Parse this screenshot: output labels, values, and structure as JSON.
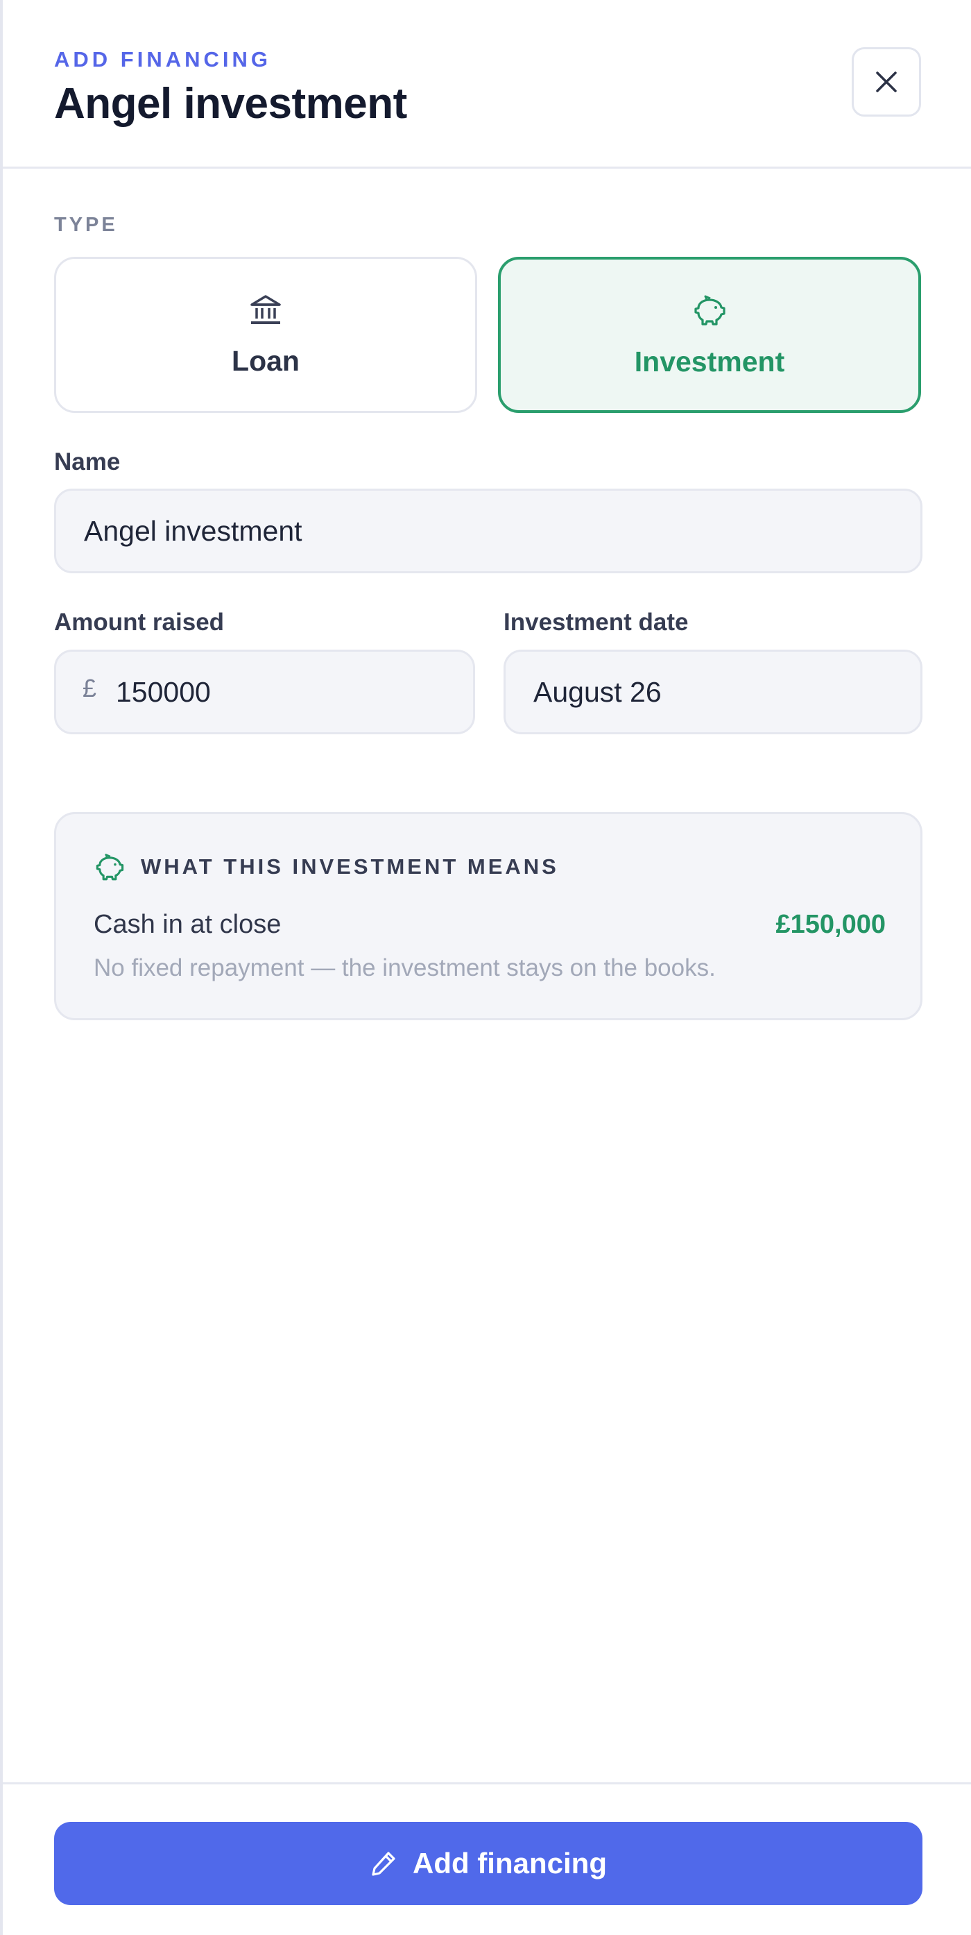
{
  "header": {
    "eyebrow": "ADD FINANCING",
    "title": "Angel investment",
    "close_icon": "close-icon"
  },
  "type_section": {
    "label": "TYPE",
    "options": [
      {
        "label": "Loan",
        "icon": "bank-icon",
        "selected": false
      },
      {
        "label": "Investment",
        "icon": "piggy-bank-icon",
        "selected": true
      }
    ]
  },
  "form": {
    "name": {
      "label": "Name",
      "value": "Angel investment"
    },
    "amount": {
      "label": "Amount raised",
      "currency_symbol": "£",
      "value": "150000"
    },
    "date": {
      "label": "Investment date",
      "value": "August 26"
    }
  },
  "info": {
    "title": "WHAT THIS INVESTMENT MEANS",
    "icon": "piggy-bank-icon",
    "row_label": "Cash in at close",
    "row_value": "£150,000",
    "note": "No fixed repayment — the investment stays on the books."
  },
  "footer": {
    "button_label": "Add financing",
    "button_icon": "pencil-icon"
  },
  "colors": {
    "accent": "#5069ea",
    "eyebrow": "#5566e8",
    "success": "#239565",
    "selected_bg": "#eef7f3"
  }
}
